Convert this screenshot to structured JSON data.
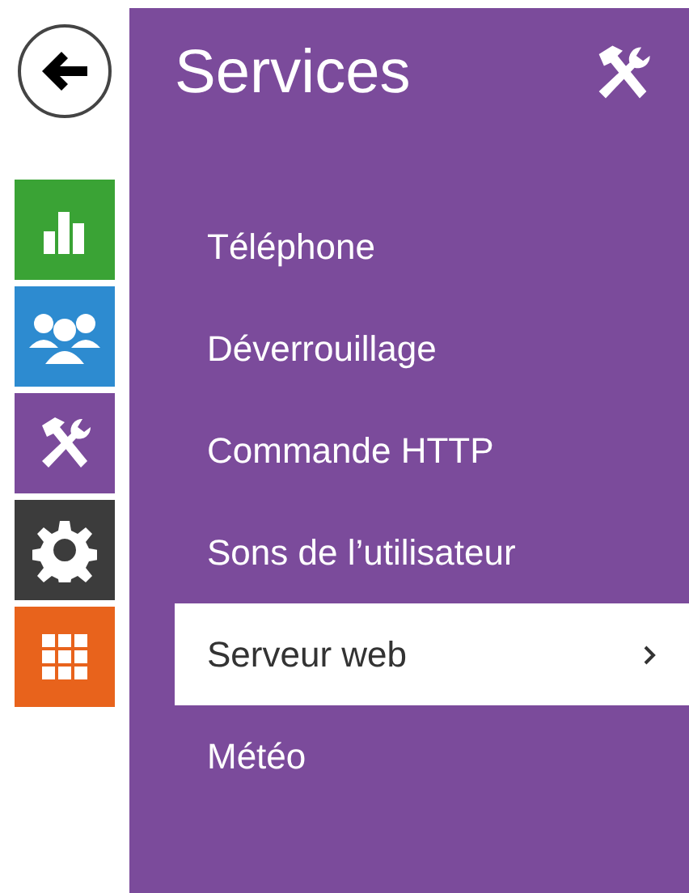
{
  "nav": [
    {
      "kind": "chart",
      "color": "#3aa335"
    },
    {
      "kind": "users",
      "color": "#2d8bd0"
    },
    {
      "kind": "tools",
      "color": "#7b4b9b"
    },
    {
      "kind": "gear",
      "color": "#3c3c3c"
    },
    {
      "kind": "grid",
      "color": "#e8631c"
    }
  ],
  "title": "Services",
  "items": [
    {
      "label": "Téléphone",
      "selected": false
    },
    {
      "label": "Déverrouillage",
      "selected": false
    },
    {
      "label": "Commande HTTP",
      "selected": false
    },
    {
      "label": "Sons de l’utilisateur",
      "selected": false
    },
    {
      "label": "Serveur web",
      "selected": true
    },
    {
      "label": "Météo",
      "selected": false
    }
  ]
}
